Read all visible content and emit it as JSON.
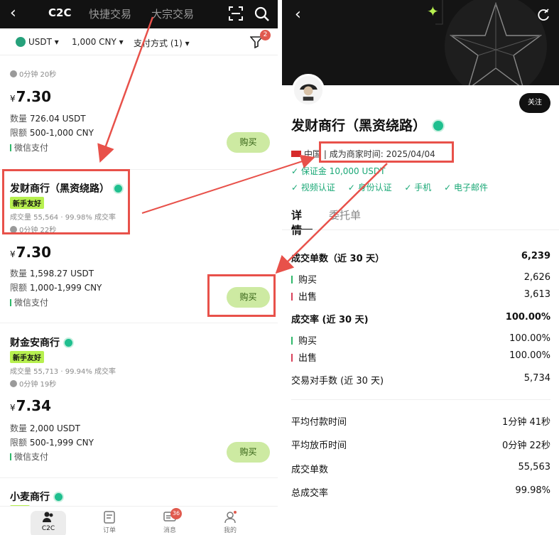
{
  "left": {
    "nav": {
      "back": "‹",
      "tabs": [
        "C2C",
        "快捷交易",
        "大宗交易"
      ]
    },
    "filters": {
      "coin": "USDT ▾",
      "amount": "1,000 CNY ▾",
      "payment": "支付方式 (1) ▾",
      "filter_badge": "2"
    },
    "listings": [
      {
        "timeline": "0分钟 20秒",
        "price_symbol": "¥",
        "price": "7.30",
        "qty_label": "数量",
        "qty": "726.04 USDT",
        "limit_label": "限额",
        "limit": "500-1,000 CNY",
        "payment": "微信支付",
        "buy": "购买"
      },
      {
        "name": "发财商行（黑资绕路）",
        "tag": "新手友好",
        "stats": "成交量 55,564 · 99.98% 成交率",
        "timeline": "0分钟 22秒",
        "price_symbol": "¥",
        "price": "7.30",
        "qty_label": "数量",
        "qty": "1,598.27 USDT",
        "limit_label": "限额",
        "limit": "1,000-1,999 CNY",
        "payment": "微信支付",
        "buy": "购买"
      },
      {
        "name": "财金安商行",
        "tag": "新手友好",
        "stats": "成交量 55,713 · 99.94% 成交率",
        "timeline": "0分钟 19秒",
        "price_symbol": "¥",
        "price": "7.34",
        "qty_label": "数量",
        "qty": "2,000 USDT",
        "limit_label": "限额",
        "limit": "500-1,999 CNY",
        "payment": "微信支付",
        "buy": "购买"
      },
      {
        "name": "小麦商行",
        "tag": "新手"
      }
    ],
    "bottom_nav": [
      {
        "label": "C2C",
        "icon": "users-icon"
      },
      {
        "label": "订单",
        "icon": "order-icon"
      },
      {
        "label": "消息",
        "icon": "message-icon",
        "badge": "36"
      },
      {
        "label": "我的",
        "icon": "profile-icon"
      }
    ]
  },
  "right": {
    "follow": "关注",
    "name": "发财商行（黑资绕路）",
    "country": "中国",
    "merchant_since_label": "| 成为商家时间:",
    "merchant_since": "2025/04/04",
    "deposit": "✓ 保证金 10,000 USDT",
    "verifications": [
      "✓ 视频认证",
      "✓ 身份认证",
      "✓ 手机",
      "✓ 电子邮件"
    ],
    "tabs": [
      "详情",
      "委托单"
    ],
    "stats": {
      "orders_30d_label": "成交单数（近 30 天）",
      "orders_30d": "6,239",
      "buy_label": "购买",
      "buy": "2,626",
      "sell_label": "出售",
      "sell": "3,613",
      "rate_30d_label": "成交率 (近 30 天)",
      "rate_30d": "100.00%",
      "rate_buy_label": "购买",
      "rate_buy": "100.00%",
      "rate_sell_label": "出售",
      "rate_sell": "100.00%",
      "counterparties_label": "交易对手数 (近 30 天)",
      "counterparties": "5,734",
      "avg_pay_label": "平均付款时间",
      "avg_pay": "1分钟 41秒",
      "avg_release_label": "平均放币时间",
      "avg_release": "0分钟 22秒",
      "total_orders_label": "成交单数",
      "total_orders": "55,563",
      "total_rate_label": "总成交率",
      "total_rate": "99.98%"
    }
  },
  "colors": {
    "annotation": "#e8514a",
    "buy_button": "#cdeaa2",
    "badge_green": "#1fbf8f",
    "tag": "#b7f04f"
  }
}
